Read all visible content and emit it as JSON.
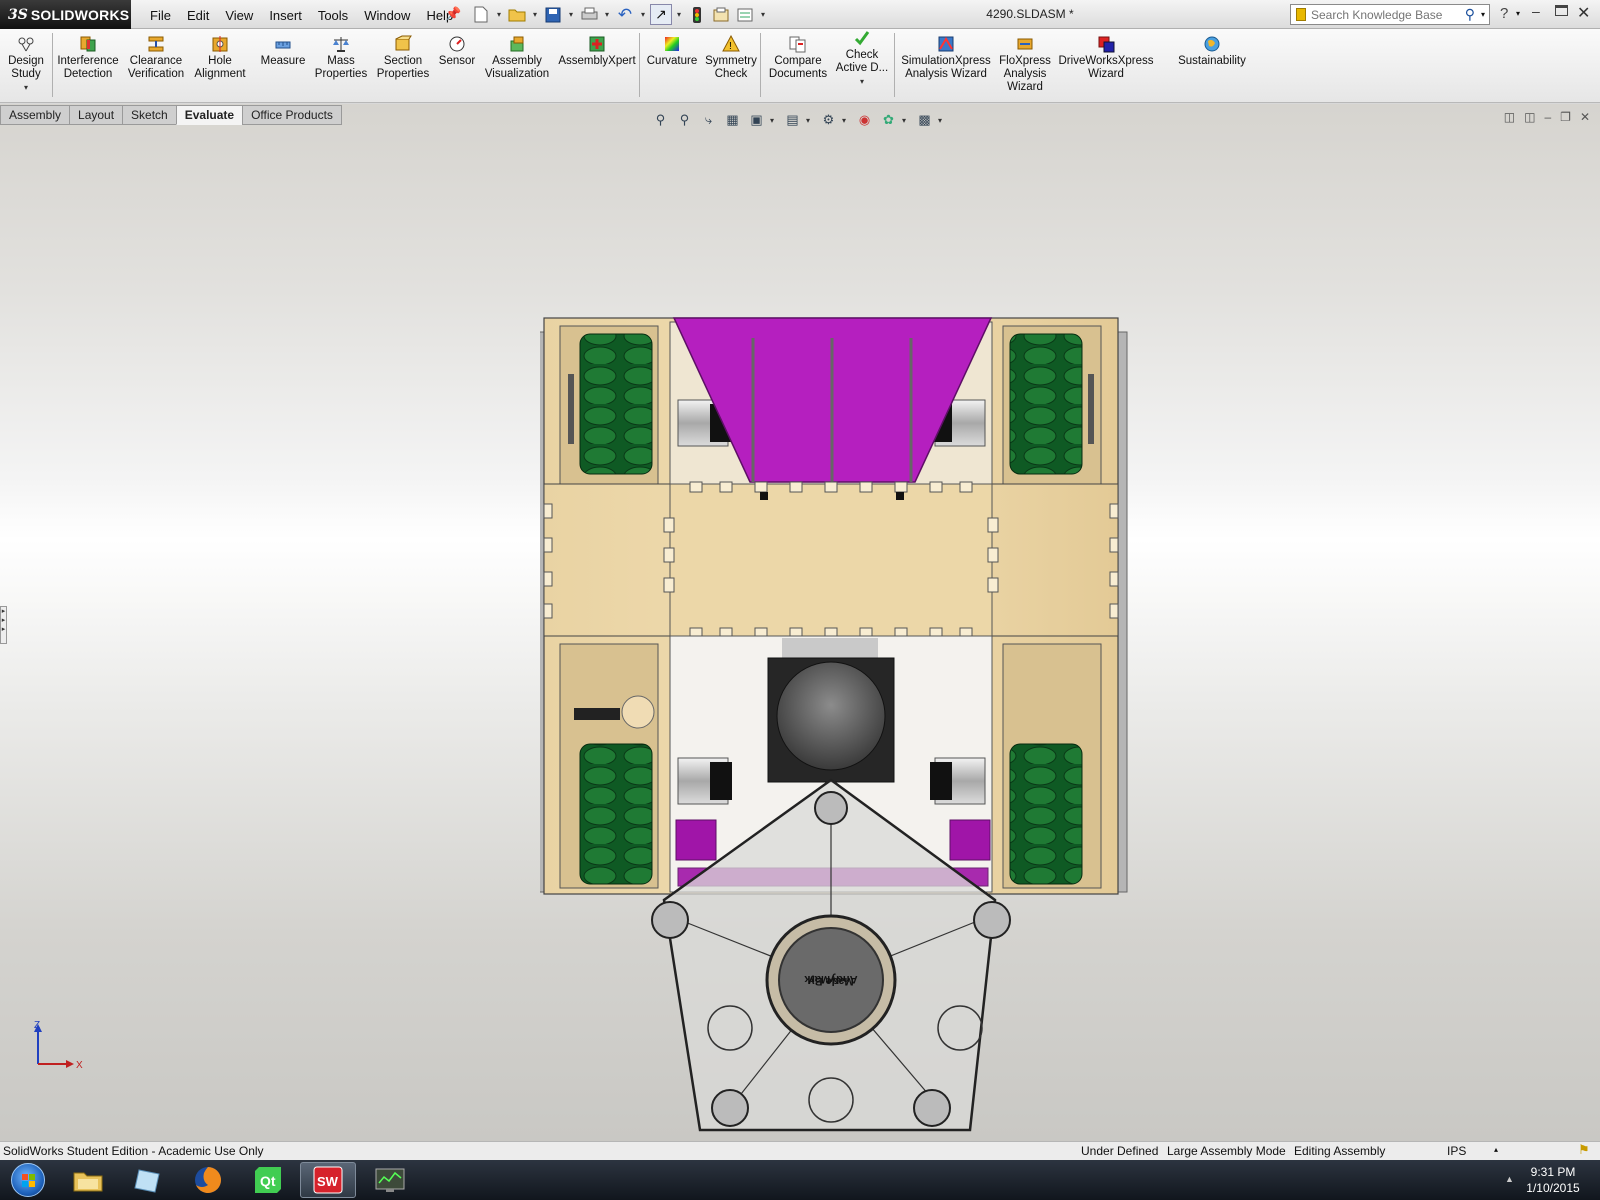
{
  "app": {
    "logo_ds": "3S",
    "logo_text": "SOLIDWORKS",
    "document_title": "4290.SLDASM *"
  },
  "menus": [
    "File",
    "Edit",
    "View",
    "Insert",
    "Tools",
    "Window",
    "Help"
  ],
  "search": {
    "placeholder": "Search Knowledge Base"
  },
  "toolbar": {
    "design_study": "Design\nStudy",
    "interference_detection": "Interference\nDetection",
    "clearance_verification": "Clearance\nVerification",
    "hole_alignment": "Hole\nAlignment",
    "measure": "Measure",
    "mass_properties": "Mass\nProperties",
    "section_properties": "Section\nProperties",
    "sensor": "Sensor",
    "assembly_visualization": "Assembly\nVisualization",
    "assemblyxpert": "AssemblyXpert",
    "curvature": "Curvature",
    "symmetry_check": "Symmetry\nCheck",
    "compare_documents": "Compare\nDocuments",
    "check_active": "Check\nActive D...",
    "simulationxpress": "SimulationXpress\nAnalysis Wizard",
    "floxpress": "FloXpress\nAnalysis\nWizard",
    "driveworksxpress": "DriveWorksXpress\nWizard",
    "sustainability": "Sustainability"
  },
  "tabs": [
    "Assembly",
    "Layout",
    "Sketch",
    "Evaluate",
    "Office Products"
  ],
  "active_tab": "Evaluate",
  "model": {
    "badge_text_line1": "Made By",
    "badge_text_line2": "AndyMark"
  },
  "triad": {
    "z": "Z",
    "x": "X"
  },
  "status": {
    "edition": "SolidWorks Student Edition - Academic Use Only",
    "defined": "Under Defined",
    "mode": "Large Assembly Mode",
    "editing": "Editing Assembly",
    "units": "IPS"
  },
  "taskbar": {
    "time": "9:31 PM",
    "date": "1/10/2015"
  },
  "colors": {
    "plywood": "#e6cf9f",
    "plywood_dark": "#b89f72",
    "hopper_magenta": "#b51fbf",
    "wheel_green": "#0f5a24",
    "bracket_purple": "#a015a8",
    "clear_polycarb": "#d9d9d7"
  },
  "icons": {
    "design_study": "design-study-icon",
    "interference_detection": "interference-detection-icon",
    "measure": "measure-icon",
    "sensor": "sensor-icon",
    "curvature": "curvature-icon",
    "taskbar_apps": [
      "file-explorer-icon",
      "notepad-icon",
      "firefox-icon",
      "qt-creator-icon",
      "solidworks-icon",
      "system-monitor-icon"
    ]
  }
}
